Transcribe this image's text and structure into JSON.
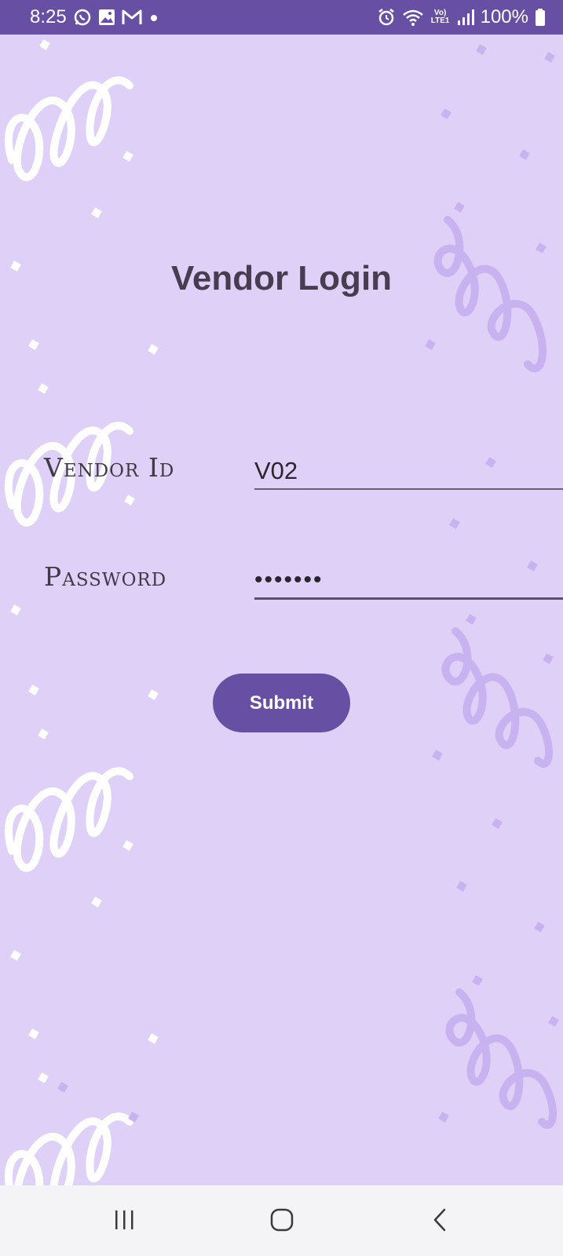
{
  "status_bar": {
    "time": "8:25",
    "network": "Vo) LTE1",
    "battery_text": "100%",
    "icons": [
      "whatsapp-icon",
      "gallery-icon",
      "gmail-icon",
      "dot-icon",
      "alarm-icon",
      "wifi-icon",
      "volte-icon",
      "signal-icon",
      "battery-icon"
    ]
  },
  "page": {
    "title": "Vendor Login"
  },
  "form": {
    "vendor_id_label": "Vendor Id",
    "vendor_id_value": "V02",
    "password_label": "Password",
    "password_value": "•••••••",
    "submit_label": "Submit"
  },
  "nav": {
    "icons": [
      "recent-apps-icon",
      "home-icon",
      "back-icon"
    ]
  },
  "colors": {
    "background": "#dfd0f8",
    "primary": "#6750a4",
    "title_text": "#463d50",
    "nav_bar": "#f4f3f6"
  }
}
